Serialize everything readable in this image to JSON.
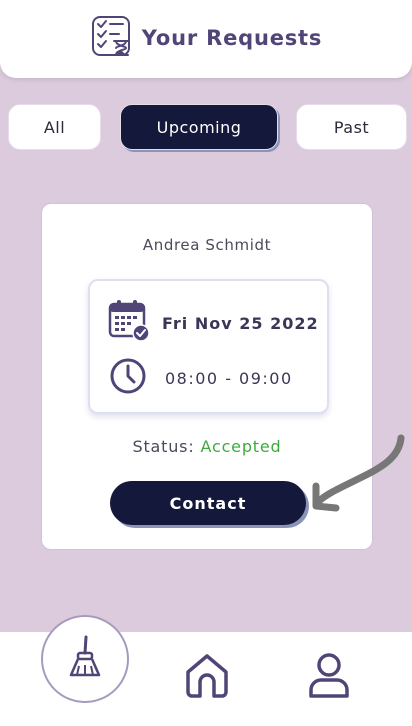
{
  "header": {
    "title": "Your Requests",
    "icon": "checklist-hourglass-icon"
  },
  "tabs": [
    {
      "label": "All",
      "active": false
    },
    {
      "label": "Upcoming",
      "active": true
    },
    {
      "label": "Past",
      "active": false
    }
  ],
  "request": {
    "name": "Andrea Schmidt",
    "date": "Fri Nov 25 2022",
    "time": "08:00 - 09:00",
    "status_label": "Status:",
    "status_value": "Accepted",
    "contact_label": "Contact"
  },
  "nav": {
    "items": [
      "broom-icon",
      "home-icon",
      "user-icon"
    ]
  },
  "colors": {
    "background": "#dccbdc",
    "primary_dark": "#14183a",
    "accent_purple": "#514577",
    "status_green": "#3dab3d"
  }
}
